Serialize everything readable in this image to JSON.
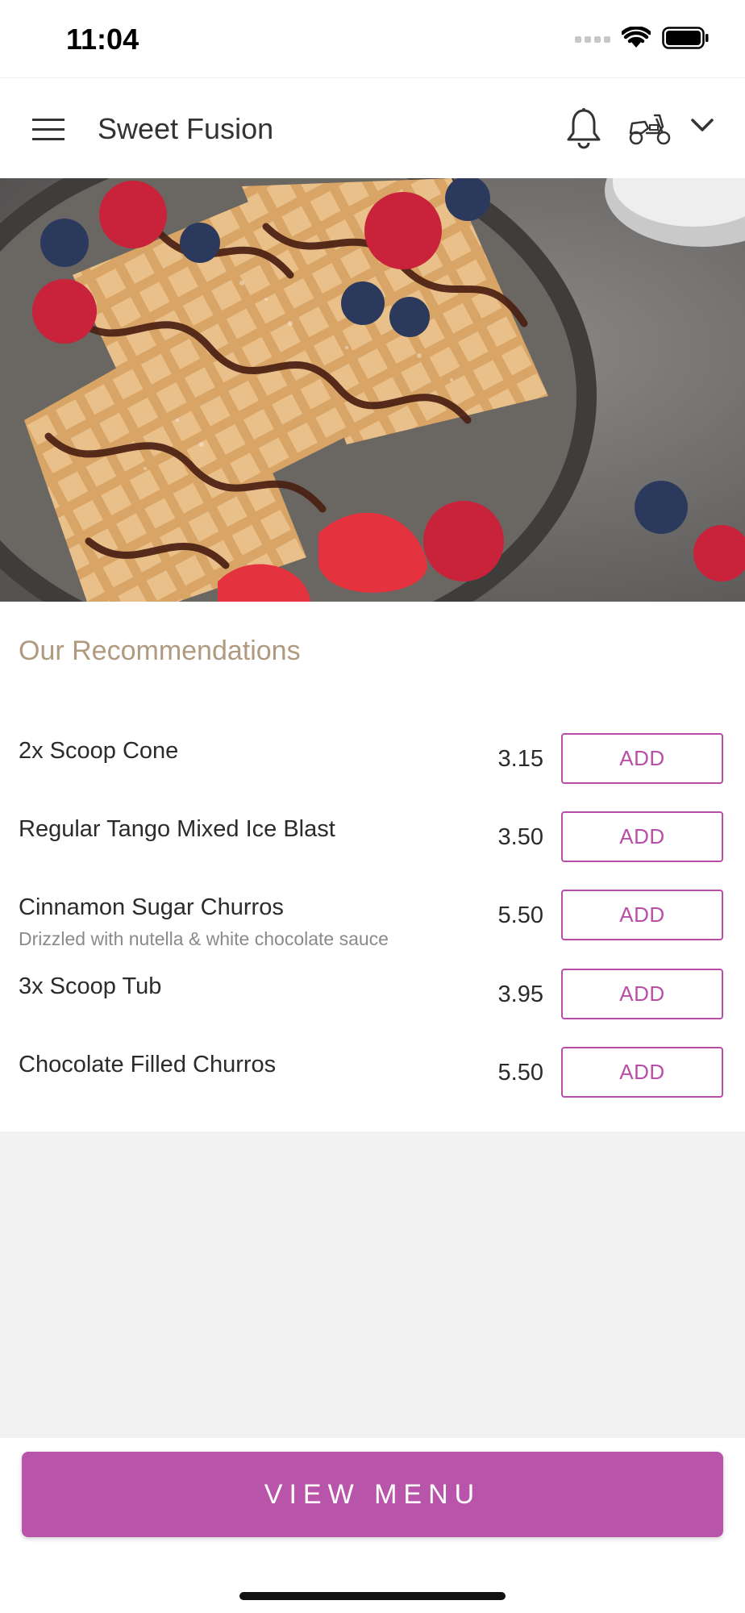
{
  "status_bar": {
    "time": "11:04"
  },
  "header": {
    "title": "Sweet Fusion",
    "icons": [
      "hamburger-menu-icon",
      "bell-icon",
      "scooter-icon",
      "chevron-down-icon"
    ]
  },
  "hero": {
    "image": "waffles with berries and chocolate sauce"
  },
  "recommendations": {
    "title": "Our Recommendations",
    "add_label": "ADD",
    "items": [
      {
        "name": "2x Scoop Cone",
        "description": "",
        "price": "3.15"
      },
      {
        "name": "Regular Tango Mixed Ice Blast",
        "description": "",
        "price": "3.50"
      },
      {
        "name": "Cinnamon Sugar Churros",
        "description": "Drizzled with nutella & white chocolate sauce",
        "price": "5.50"
      },
      {
        "name": "3x Scoop Tub",
        "description": "",
        "price": "3.95"
      },
      {
        "name": "Chocolate Filled Churros",
        "description": "",
        "price": "5.50"
      }
    ]
  },
  "footer": {
    "view_menu_label": "VIEW MENU"
  },
  "colors": {
    "accent": "#b855aa",
    "section_title": "#b09a7f",
    "page_background": "#f2f2f2"
  }
}
